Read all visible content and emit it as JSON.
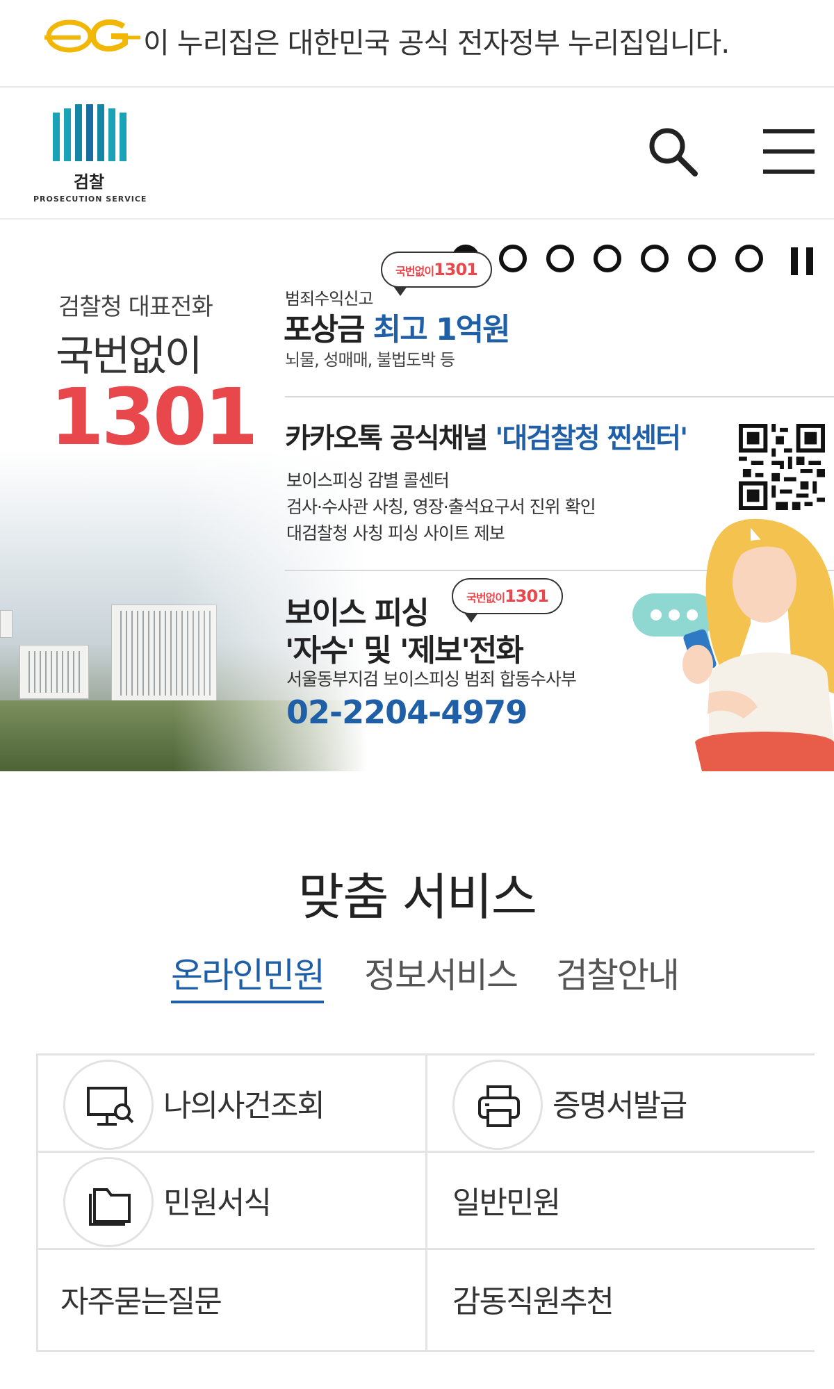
{
  "gov_banner": {
    "logo_text": "eG",
    "text": "이 누리집은 대한민국 공식 전자정부 누리집입니다."
  },
  "header": {
    "logo_kor": "검찰",
    "logo_eng": "PROSECUTION SERVICE",
    "search_icon": "search-icon",
    "menu_icon": "hamburger-menu-icon"
  },
  "hero": {
    "subtitle": "검찰청 대표전화",
    "main_text": "국번없이",
    "number": "1301",
    "slides_total": 7,
    "active_slide": 1,
    "block1": {
      "label": "범죄수익신고",
      "title_plain": "포상금",
      "title_highlight": "최고 1억원",
      "desc": "뇌물, 성매매, 불법도박 등",
      "bubble_small": "국번없이",
      "bubble_num": "1301"
    },
    "block2": {
      "title_plain": "카카오톡 공식채널",
      "title_highlight": "'대검찰청 찐센터'",
      "lines": [
        "보이스피싱 감별 콜센터",
        "검사·수사관 사칭, 영장·출석요구서 진위 확인",
        "대검찰청 사칭 피싱 사이트 제보"
      ]
    },
    "block3": {
      "title1": "보이스 피싱",
      "title2": "'자수' 및 '제보'전화",
      "org": "서울동부지검 보이스피싱 범죄 합동수사부",
      "phone": "02-2204-4979",
      "bubble_small": "국번없이",
      "bubble_num": "1301"
    },
    "accent_red": "#e8474c",
    "accent_blue": "#1f5fa8"
  },
  "services": {
    "title": "맞춤 서비스",
    "tabs": [
      {
        "label": "온라인민원",
        "active": true
      },
      {
        "label": "정보서비스",
        "active": false
      },
      {
        "label": "검찰안내",
        "active": false
      }
    ],
    "items": [
      {
        "label": "나의사건조회",
        "icon": "monitor-search-icon"
      },
      {
        "label": "증명서발급",
        "icon": "printer-icon"
      },
      {
        "label": "민원서식",
        "icon": "folder-icon"
      },
      {
        "label": "일반민원",
        "icon": ""
      },
      {
        "label": "자주묻는질문",
        "icon": ""
      },
      {
        "label": "감동직원추천",
        "icon": ""
      }
    ]
  }
}
